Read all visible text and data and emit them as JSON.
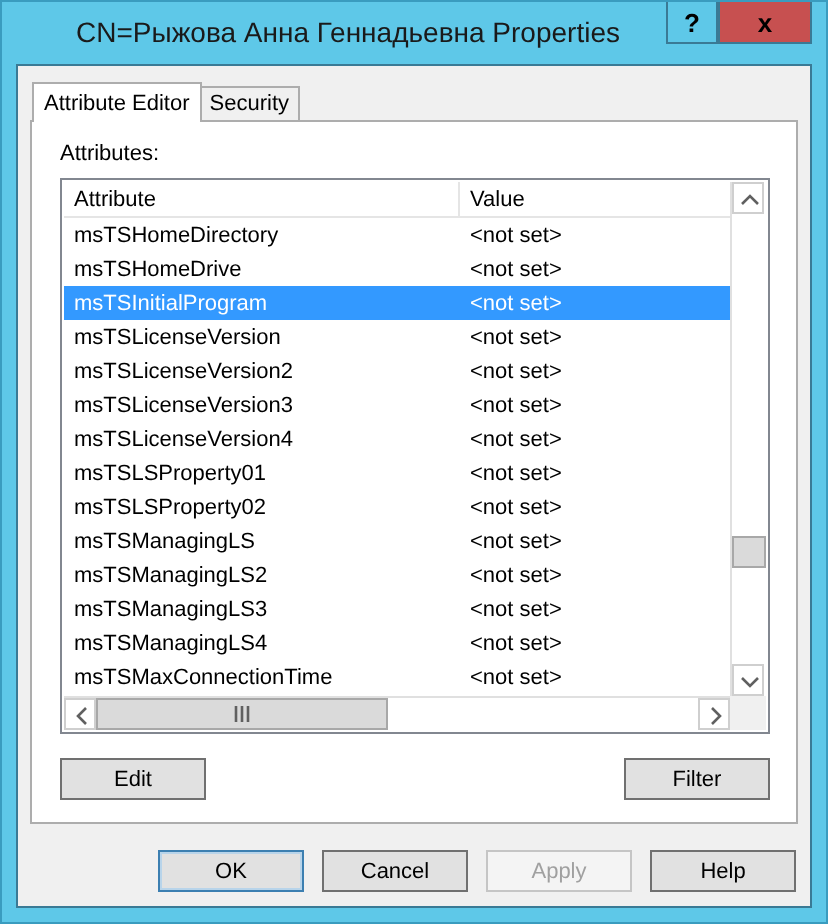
{
  "window": {
    "title": "CN=Рыжова Анна Геннадьевна Properties",
    "help_button": "?",
    "close_button": "x"
  },
  "tabs": [
    {
      "label": "Attribute Editor",
      "selected": true
    },
    {
      "label": "Security",
      "selected": false
    }
  ],
  "attributes_label": "Attributes:",
  "table": {
    "columns": [
      "Attribute",
      "Value"
    ],
    "rows": [
      {
        "attribute": "msTSHomeDirectory",
        "value": "<not set>",
        "selected": false
      },
      {
        "attribute": "msTSHomeDrive",
        "value": "<not set>",
        "selected": false
      },
      {
        "attribute": "msTSInitialProgram",
        "value": "<not set>",
        "selected": true
      },
      {
        "attribute": "msTSLicenseVersion",
        "value": "<not set>",
        "selected": false
      },
      {
        "attribute": "msTSLicenseVersion2",
        "value": "<not set>",
        "selected": false
      },
      {
        "attribute": "msTSLicenseVersion3",
        "value": "<not set>",
        "selected": false
      },
      {
        "attribute": "msTSLicenseVersion4",
        "value": "<not set>",
        "selected": false
      },
      {
        "attribute": "msTSLSProperty01",
        "value": "<not set>",
        "selected": false
      },
      {
        "attribute": "msTSLSProperty02",
        "value": "<not set>",
        "selected": false
      },
      {
        "attribute": "msTSManagingLS",
        "value": "<not set>",
        "selected": false
      },
      {
        "attribute": "msTSManagingLS2",
        "value": "<not set>",
        "selected": false
      },
      {
        "attribute": "msTSManagingLS3",
        "value": "<not set>",
        "selected": false
      },
      {
        "attribute": "msTSManagingLS4",
        "value": "<not set>",
        "selected": false
      },
      {
        "attribute": "msTSMaxConnectionTime",
        "value": "<not set>",
        "selected": false
      }
    ]
  },
  "panel_buttons": [
    {
      "label": "Edit"
    },
    {
      "label": "Filter"
    }
  ],
  "buttons": [
    {
      "label": "OK",
      "default": true,
      "disabled": false
    },
    {
      "label": "Cancel",
      "default": false,
      "disabled": false
    },
    {
      "label": "Apply",
      "default": false,
      "disabled": true
    },
    {
      "label": "Help",
      "default": false,
      "disabled": false
    }
  ]
}
